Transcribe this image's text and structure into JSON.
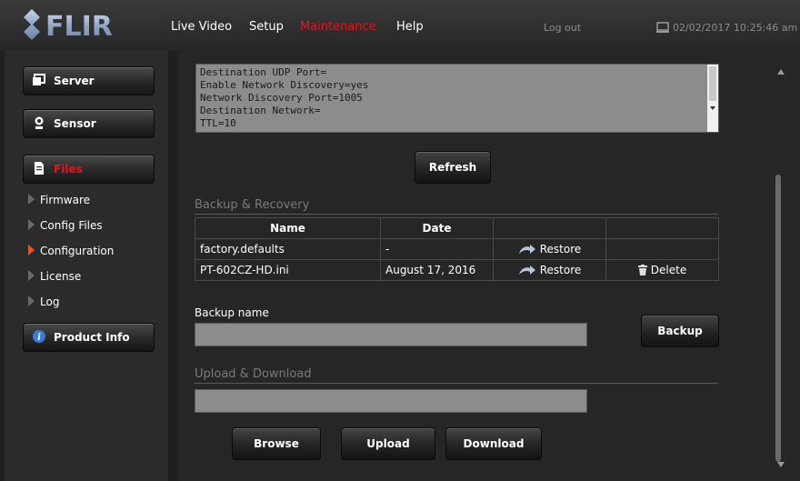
{
  "header": {
    "logo_text": "FLIR",
    "nav": {
      "live_video": "Live Video",
      "setup": "Setup",
      "maintenance": "Maintenance",
      "help": "Help"
    },
    "logout": "Log out",
    "datetime": "02/02/2017 10:25:46 am",
    "accent_color": "#e8141b"
  },
  "sidebar": {
    "server": "Server",
    "sensor": "Sensor",
    "files": "Files",
    "subitems": [
      "Firmware",
      "Config Files",
      "Configuration",
      "License",
      "Log"
    ],
    "active_subitem": "Configuration",
    "product_info": "Product Info"
  },
  "config_text": {
    "content": "Destination UDP Port=\nEnable Network Discovery=yes\nNetwork Discovery Port=1005\nDestination Network=\nTTL=10"
  },
  "buttons": {
    "refresh": "Refresh",
    "backup": "Backup",
    "browse": "Browse",
    "upload": "Upload",
    "download": "Download"
  },
  "backup_recovery": {
    "title": "Backup & Recovery",
    "columns": {
      "name": "Name",
      "date": "Date"
    },
    "rows": [
      {
        "name": "factory.defaults",
        "date": "-",
        "restore": "Restore",
        "delete": ""
      },
      {
        "name": "PT-602CZ-HD.ini",
        "date": "August 17, 2016",
        "restore": "Restore",
        "delete": "Delete"
      }
    ]
  },
  "backup_name": {
    "label": "Backup name",
    "value": ""
  },
  "upload_download": {
    "title": "Upload & Download",
    "value": ""
  }
}
